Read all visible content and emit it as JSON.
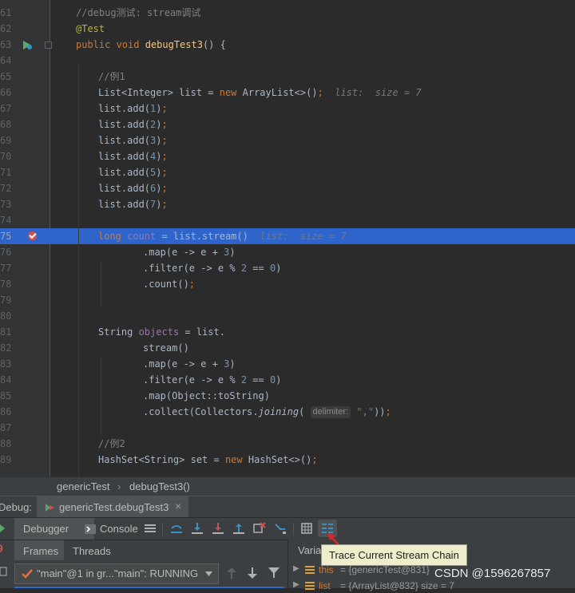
{
  "editor": {
    "lines": [
      {
        "num": "61",
        "segments": [
          {
            "t": "//debug测试: stream调试",
            "c": "comment"
          }
        ],
        "indent": 95
      },
      {
        "num": "62",
        "segments": [
          {
            "t": "@Test",
            "c": "annot"
          }
        ],
        "indent": 95
      },
      {
        "num": "63",
        "segments": [
          {
            "t": "public ",
            "c": "kw"
          },
          {
            "t": "void ",
            "c": "kw"
          },
          {
            "t": "debugTest3",
            "c": "fn"
          },
          {
            "t": "() {",
            "c": "plain"
          }
        ],
        "indent": 95
      },
      {
        "num": "64",
        "segments": [],
        "indent": 95
      },
      {
        "num": "65",
        "segments": [
          {
            "t": "//例1",
            "c": "comment"
          }
        ],
        "indent": 123
      },
      {
        "num": "66",
        "segments": [
          {
            "t": "List<Integer> list = ",
            "c": "plain"
          },
          {
            "t": "new ",
            "c": "kw"
          },
          {
            "t": "ArrayList<>()",
            "c": "plain"
          },
          {
            "t": ";",
            "c": "punc"
          },
          {
            "t": "  list:  size = 7",
            "c": "hint"
          }
        ],
        "indent": 123
      },
      {
        "num": "67",
        "segments": [
          {
            "t": "list.add(",
            "c": "plain"
          },
          {
            "t": "1",
            "c": "num"
          },
          {
            "t": ")",
            "c": "plain"
          },
          {
            "t": ";",
            "c": "punc"
          }
        ],
        "indent": 123
      },
      {
        "num": "68",
        "segments": [
          {
            "t": "list.add(",
            "c": "plain"
          },
          {
            "t": "2",
            "c": "num"
          },
          {
            "t": ")",
            "c": "plain"
          },
          {
            "t": ";",
            "c": "punc"
          }
        ],
        "indent": 123
      },
      {
        "num": "69",
        "segments": [
          {
            "t": "list.add(",
            "c": "plain"
          },
          {
            "t": "3",
            "c": "num"
          },
          {
            "t": ")",
            "c": "plain"
          },
          {
            "t": ";",
            "c": "punc"
          }
        ],
        "indent": 123
      },
      {
        "num": "70",
        "segments": [
          {
            "t": "list.add(",
            "c": "plain"
          },
          {
            "t": "4",
            "c": "num"
          },
          {
            "t": ")",
            "c": "plain"
          },
          {
            "t": ";",
            "c": "punc"
          }
        ],
        "indent": 123
      },
      {
        "num": "71",
        "segments": [
          {
            "t": "list.add(",
            "c": "plain"
          },
          {
            "t": "5",
            "c": "num"
          },
          {
            "t": ")",
            "c": "plain"
          },
          {
            "t": ";",
            "c": "punc"
          }
        ],
        "indent": 123
      },
      {
        "num": "72",
        "segments": [
          {
            "t": "list.add(",
            "c": "plain"
          },
          {
            "t": "6",
            "c": "num"
          },
          {
            "t": ")",
            "c": "plain"
          },
          {
            "t": ";",
            "c": "punc"
          }
        ],
        "indent": 123
      },
      {
        "num": "73",
        "segments": [
          {
            "t": "list.add(",
            "c": "plain"
          },
          {
            "t": "7",
            "c": "num"
          },
          {
            "t": ")",
            "c": "plain"
          },
          {
            "t": ";",
            "c": "punc"
          }
        ],
        "indent": 123
      },
      {
        "num": "74",
        "segments": [],
        "indent": 123
      },
      {
        "num": "75",
        "segments": [
          {
            "t": "long ",
            "c": "kw"
          },
          {
            "t": "count",
            "c": "var"
          },
          {
            "t": " = list.stream()",
            "c": "plain"
          },
          {
            "t": "  list:  size = 7",
            "c": "hint"
          }
        ],
        "indent": 123,
        "current": true
      },
      {
        "num": "76",
        "segments": [
          {
            "t": ".map(e -> e + ",
            "c": "plain"
          },
          {
            "t": "3",
            "c": "num"
          },
          {
            "t": ")",
            "c": "plain"
          }
        ],
        "indent": 179
      },
      {
        "num": "77",
        "segments": [
          {
            "t": ".filter(e -> e % ",
            "c": "plain"
          },
          {
            "t": "2",
            "c": "num"
          },
          {
            "t": " == ",
            "c": "plain"
          },
          {
            "t": "0",
            "c": "num"
          },
          {
            "t": ")",
            "c": "plain"
          }
        ],
        "indent": 179
      },
      {
        "num": "78",
        "segments": [
          {
            "t": ".count()",
            "c": "plain"
          },
          {
            "t": ";",
            "c": "punc"
          }
        ],
        "indent": 179
      },
      {
        "num": "79",
        "segments": [],
        "indent": 123
      },
      {
        "num": "80",
        "segments": [],
        "indent": 123
      },
      {
        "num": "81",
        "segments": [
          {
            "t": "String ",
            "c": "plain"
          },
          {
            "t": "objects",
            "c": "var"
          },
          {
            "t": " = list.",
            "c": "plain"
          }
        ],
        "indent": 123
      },
      {
        "num": "82",
        "segments": [
          {
            "t": "stream()",
            "c": "plain"
          }
        ],
        "indent": 179
      },
      {
        "num": "83",
        "segments": [
          {
            "t": ".map(e -> e + ",
            "c": "plain"
          },
          {
            "t": "3",
            "c": "num"
          },
          {
            "t": ")",
            "c": "plain"
          }
        ],
        "indent": 179
      },
      {
        "num": "84",
        "segments": [
          {
            "t": ".filter(e -> e % ",
            "c": "plain"
          },
          {
            "t": "2",
            "c": "num"
          },
          {
            "t": " == ",
            "c": "plain"
          },
          {
            "t": "0",
            "c": "num"
          },
          {
            "t": ")",
            "c": "plain"
          }
        ],
        "indent": 179
      },
      {
        "num": "85",
        "segments": [
          {
            "t": ".map(Object::toString)",
            "c": "plain"
          }
        ],
        "indent": 179
      },
      {
        "num": "86",
        "segments": [
          {
            "t": ".collect(Collectors.",
            "c": "plain"
          },
          {
            "t": "joining",
            "c": "italic"
          },
          {
            "t": "( ",
            "c": "plain"
          },
          {
            "t": "delimiter:",
            "c": "paramhint"
          },
          {
            "t": " ",
            "c": "plain"
          },
          {
            "t": "\",\"",
            "c": "str"
          },
          {
            "t": "))",
            "c": "plain"
          },
          {
            "t": ";",
            "c": "punc"
          }
        ],
        "indent": 179
      },
      {
        "num": "87",
        "segments": [],
        "indent": 123
      },
      {
        "num": "88",
        "segments": [
          {
            "t": "//例2",
            "c": "comment"
          }
        ],
        "indent": 123
      },
      {
        "num": "89",
        "segments": [
          {
            "t": "HashSet<String> set = ",
            "c": "plain"
          },
          {
            "t": "new ",
            "c": "kw"
          },
          {
            "t": "HashSet<>()",
            "c": "plain"
          },
          {
            "t": ";",
            "c": "punc"
          }
        ],
        "indent": 123
      }
    ]
  },
  "breadcrumb": {
    "class_name": "genericTest",
    "method_name": "debugTest3()",
    "separator": "›"
  },
  "debug_panel": {
    "label": "Debug:",
    "session_tab": "genericTest.debugTest3",
    "close_glyph": "×",
    "tabs": {
      "debugger": "Debugger",
      "console": "Console"
    },
    "subtabs": {
      "frames": "Frames",
      "threads": "Threads"
    },
    "thread_select": "\"main\"@1 in gr...\"main\": RUNNING",
    "variables_label": "Variab",
    "variables": [
      {
        "name": "this",
        "value": "= {genericTest@831}"
      },
      {
        "name": "list",
        "value": "= {ArrayList@832}  size = 7"
      }
    ],
    "left_numbers": {
      "nine": "9"
    }
  },
  "tooltip": {
    "text": "Trace Current Stream Chain"
  },
  "watermark": {
    "text": "CSDN @1596267857"
  },
  "colors": {
    "current_line": "#2f65ca",
    "tooltip_bg": "#eeeecd",
    "arrow": "#e0252b"
  }
}
